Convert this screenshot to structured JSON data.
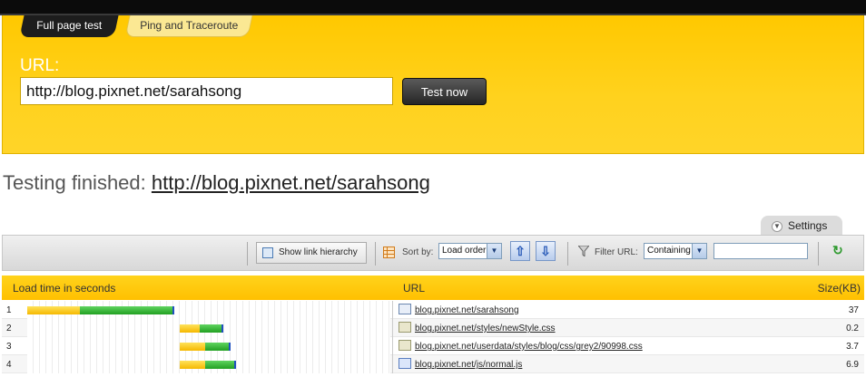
{
  "tabs": {
    "active": "Full page test",
    "inactive": "Ping and Traceroute"
  },
  "form": {
    "url_label": "URL:",
    "url_value": "http://blog.pixnet.net/sarahsong",
    "test_button": "Test now"
  },
  "result": {
    "prefix": "Testing finished:",
    "link": "http://blog.pixnet.net/sarahsong"
  },
  "settings": {
    "label": "Settings"
  },
  "toolbar": {
    "hierarchy_button": "Show link hierarchy",
    "sort_label": "Sort by:",
    "sort_value": "Load order",
    "filter_label": "Filter URL:",
    "filter_value": "Containing",
    "filter_text": ""
  },
  "table": {
    "headers": {
      "time": "Load time in seconds",
      "url": "URL",
      "size": "Size(KB)"
    },
    "rows": [
      {
        "num": "1",
        "url": "blog.pixnet.net/sarahsong",
        "size": "37",
        "type": "html",
        "wait_start": 0.0,
        "wait_end": 0.145,
        "load_end": 0.405
      },
      {
        "num": "2",
        "url": "blog.pixnet.net/styles/newStyle.css",
        "size": "0.2",
        "type": "css",
        "wait_start": 0.42,
        "wait_end": 0.475,
        "load_end": 0.54
      },
      {
        "num": "3",
        "url": "blog.pixnet.net/userdata/styles/blog/css/grey2/90998.css",
        "size": "3.7",
        "type": "css",
        "wait_start": 0.42,
        "wait_end": 0.49,
        "load_end": 0.56
      },
      {
        "num": "4",
        "url": "blog.pixnet.net/js/normal.js",
        "size": "6.9",
        "type": "js",
        "wait_start": 0.42,
        "wait_end": 0.49,
        "load_end": 0.575
      }
    ]
  },
  "colors": {
    "panel_yellow": "#ffc800",
    "wait_bar": "#f5b800",
    "load_bar": "#22a022",
    "topbar": "#0b0b0b"
  },
  "icons": [
    "dropdown-circle-icon",
    "hierarchy-icon",
    "grid-icon",
    "sort-up-icon",
    "sort-down-icon",
    "filter-funnel-icon",
    "go-arrow-icon",
    "html-file-icon",
    "css-file-icon",
    "js-file-icon"
  ]
}
